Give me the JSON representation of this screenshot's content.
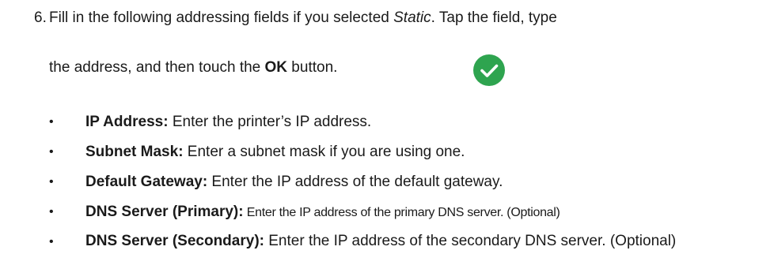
{
  "step": {
    "number": "6.",
    "line1_a": "Fill in the following addressing fields if you selected ",
    "line1_italic": "Static",
    "line1_b": ". Tap the field, type",
    "line2_a": "the address, and then touch the ",
    "line2_bold": "OK",
    "line2_b": " button.",
    "ok_icon": "check-circle-icon",
    "ok_icon_color": "#2ea44f"
  },
  "fields": [
    {
      "label": "IP Address:",
      "desc": " Enter the printer’s IP address."
    },
    {
      "label": "Subnet Mask:",
      "desc": " Enter a subnet mask if you are using one."
    },
    {
      "label": "Default Gateway:",
      "desc": " Enter the IP address of the default gateway."
    },
    {
      "label": "DNS Server (Primary):",
      "desc": " Enter the IP address of the primary DNS server. (Optional)"
    },
    {
      "label": "DNS Server (Secondary):",
      "desc": " Enter the IP address of the secondary DNS server. (Optional)"
    }
  ],
  "bullet_char": "•"
}
